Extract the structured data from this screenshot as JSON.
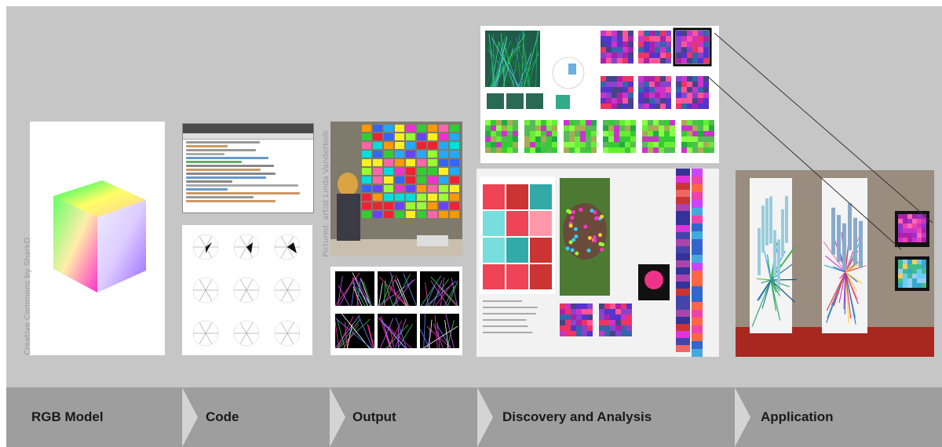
{
  "credits": {
    "cube": "Creative Commons by SharkD",
    "photo": "Pictured: artist Linda Vanderkolk"
  },
  "steps": [
    {
      "label": "RGB Model"
    },
    {
      "label": "Code"
    },
    {
      "label": "Output"
    },
    {
      "label": "Discovery and Analysis"
    },
    {
      "label": "Application"
    }
  ],
  "colors": {
    "stage": "#c6c6c6",
    "footer": "#9e9e9e",
    "chevron": "#d4d4d4"
  }
}
